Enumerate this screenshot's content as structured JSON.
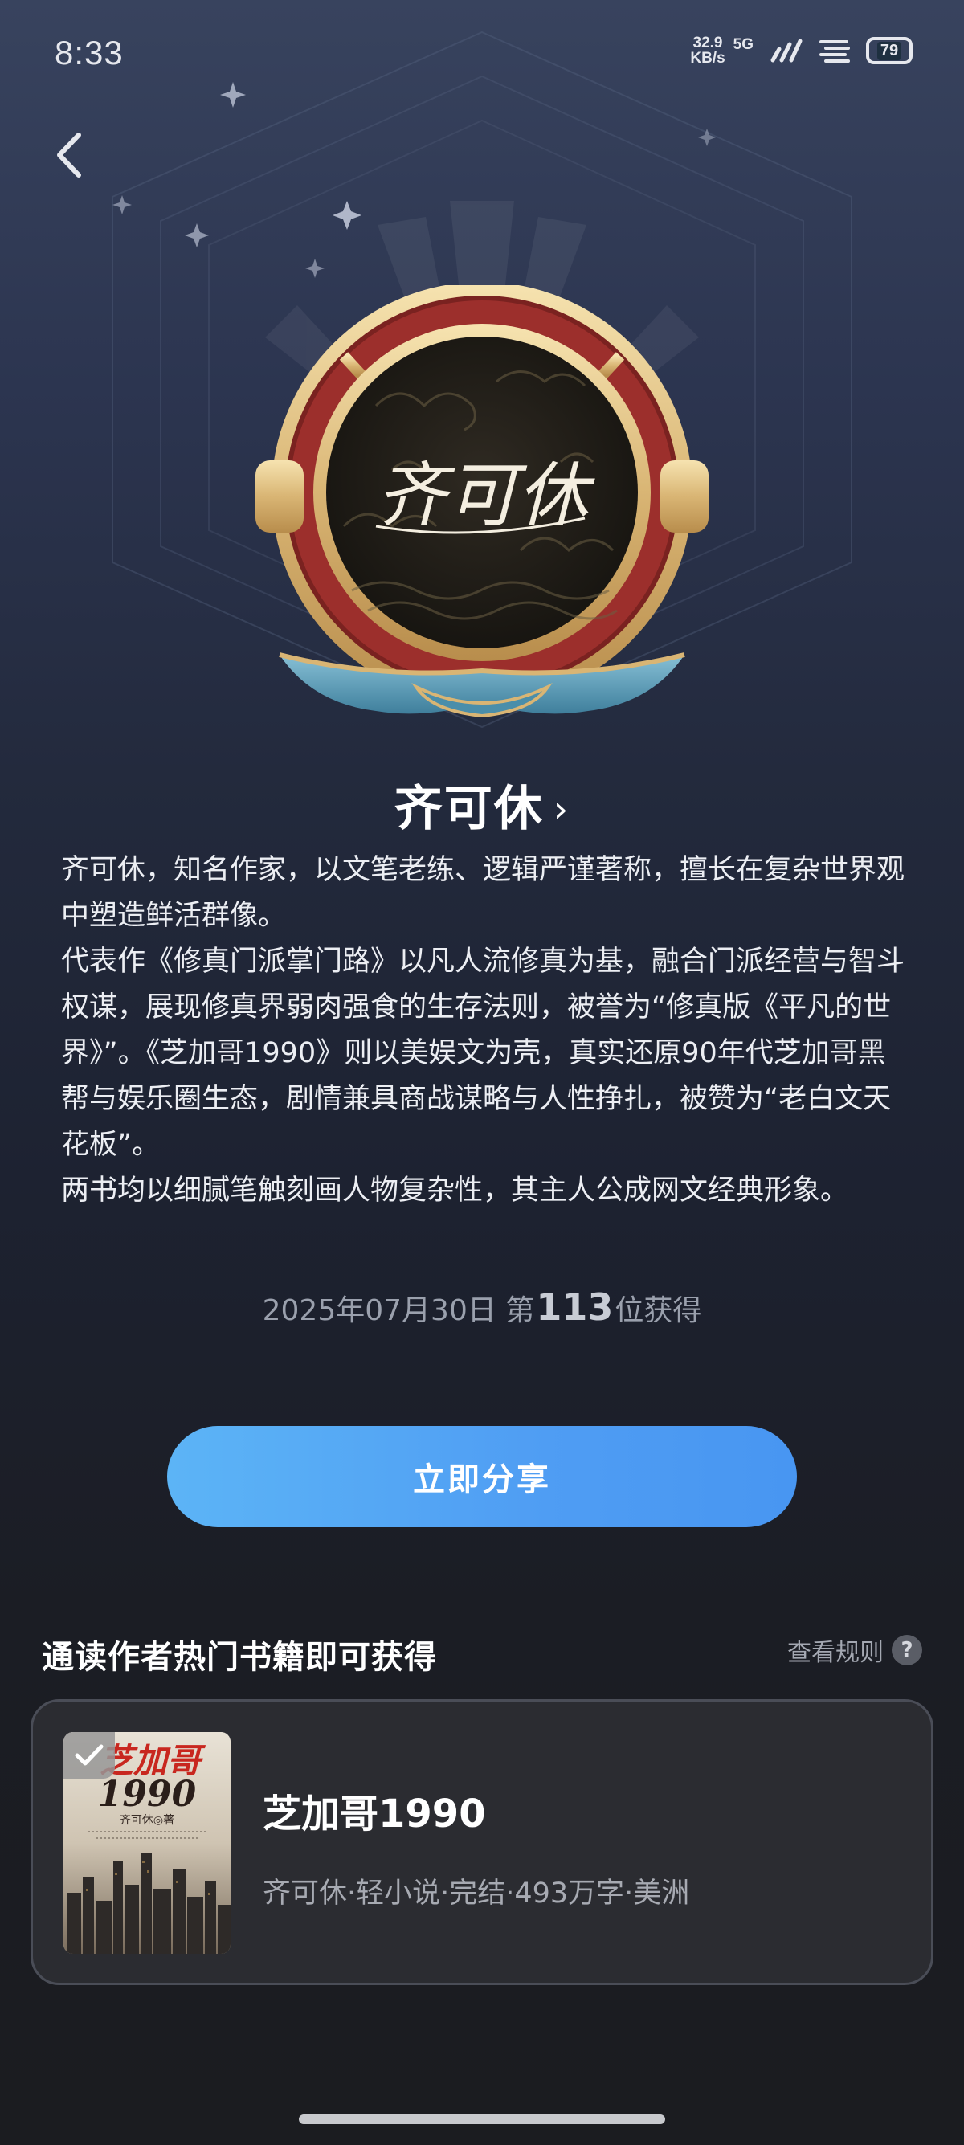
{
  "status_bar": {
    "time": "8:33",
    "net_speed_value": "32.9",
    "net_speed_unit": "KB/s",
    "network": "5G",
    "battery": "79"
  },
  "medal": {
    "signature": "齐可休"
  },
  "author": {
    "name": "齐可休",
    "bio": [
      "齐可休，知名作家，以文笔老练、逻辑严谨著称，擅长在复杂世界观中塑造鲜活群像。",
      "代表作《修真门派掌门路》以凡人流修真为基，融合门派经营与智斗权谋，展现修真界弱肉强食的生存法则，被誉为“修真版《平凡的世界》”。《芝加哥1990》则以美娱文为壳，真实还原90年代芝加哥黑帮与娱乐圈生态，剧情兼具商战谋略与人性挣扎，被赞为“老白文天花板”。",
      "两书均以细腻笔触刻画人物复杂性，其主人公成网文经典形象。"
    ]
  },
  "obtain": {
    "date": "2025年07月30日",
    "prefix": "第",
    "rank": "113",
    "suffix": "位获得"
  },
  "share_button": "立即分享",
  "section": {
    "title": "通读作者热门书籍即可获得",
    "rules_label": "查看规则",
    "rules_icon": "?"
  },
  "book": {
    "title": "芝加哥1990",
    "meta": "齐可休·轻小说·完结·493万字·美洲",
    "cover_title_line1": "芝加哥",
    "cover_title_line2": "1990",
    "cover_author": "齐可休◎著"
  },
  "colors": {
    "accent_blue": "#4f9df3",
    "gold": "#e6c98a",
    "medal_red": "#9c2f2c",
    "ribbon_blue": "#5d9fbd"
  }
}
